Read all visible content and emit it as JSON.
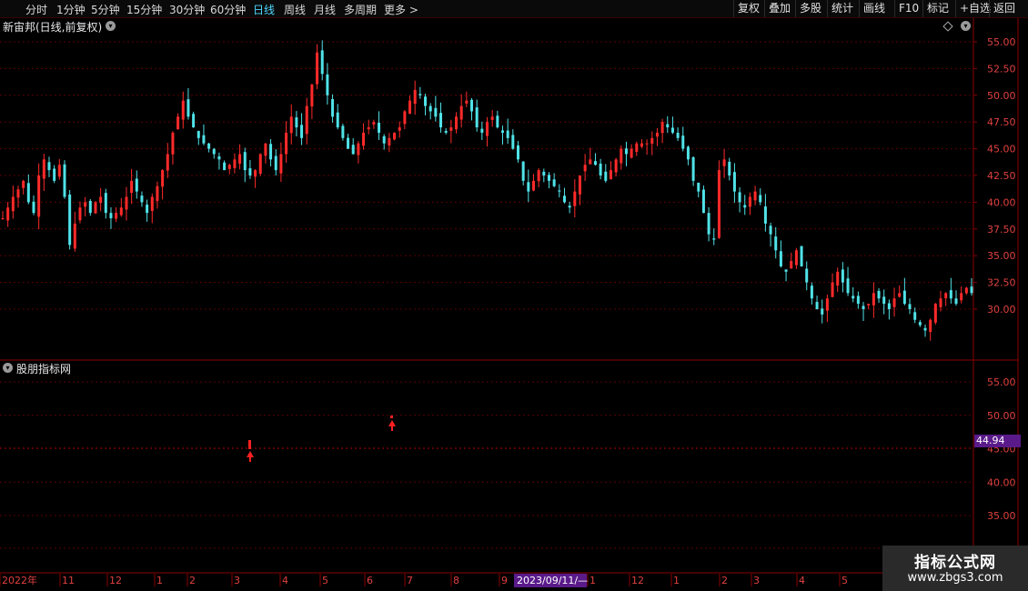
{
  "toolbar": {
    "periods": [
      "分时",
      "1分钟",
      "5分钟",
      "15分钟",
      "30分钟",
      "60分钟",
      "日线",
      "周线",
      "月线",
      "多周期",
      "更多 >"
    ],
    "active_period": "日线",
    "right_buttons": [
      "复权",
      "叠加",
      "多股",
      "统计",
      "画线",
      "F10",
      "标记",
      "+自选",
      "返回"
    ]
  },
  "main_panel": {
    "title": "新宙邦(日线,前复权)",
    "y_ticks": [
      "55.00",
      "52.50",
      "50.00",
      "47.50",
      "45.00",
      "42.50",
      "40.00",
      "37.50",
      "35.00",
      "32.50",
      "30.00"
    ]
  },
  "indicator_panel": {
    "title": "股朋指标网",
    "y_ticks": [
      "55.00",
      "50.00",
      "45.00",
      "40.00",
      "35.00"
    ],
    "current_value": "44.94"
  },
  "x_axis": {
    "labels": [
      "2022年",
      "11",
      "12",
      "1",
      "2",
      "3",
      "4",
      "5",
      "6",
      "7",
      "8",
      "9",
      "1",
      "12",
      "1",
      "2",
      "3",
      "4",
      "5"
    ],
    "cursor_date": "2023/09/11/—"
  },
  "watermark": {
    "title": "指标公式网",
    "url": "www.zbgs3.com"
  },
  "colors": {
    "up": "#ff2a2a",
    "down": "#4fe3e8",
    "grid": "#5a0000",
    "axis": "#8b0000",
    "accent": "#4fd6ff"
  },
  "chart_data": {
    "type": "candlestick",
    "title": "新宙邦(日线,前复权)",
    "xlabel": "",
    "ylabel": "",
    "ylim": [
      27.5,
      56.0
    ],
    "grid": true,
    "values": [
      38.5,
      39.5,
      40.5,
      41.2,
      42.0,
      40.0,
      39.0,
      42.5,
      44.0,
      43.0,
      42.0,
      43.5,
      40.5,
      36.0,
      38.0,
      39.5,
      40.0,
      39.0,
      40.0,
      40.5,
      39.0,
      38.5,
      39.0,
      39.5,
      40.5,
      42.0,
      41.0,
      40.0,
      39.0,
      40.5,
      41.5,
      43.0,
      44.5,
      46.5,
      48.0,
      49.5,
      48.0,
      47.0,
      46.0,
      45.5,
      45.0,
      44.5,
      44.0,
      43.0,
      43.5,
      44.0,
      44.5,
      43.0,
      42.5,
      43.0,
      44.5,
      45.5,
      44.0,
      43.0,
      44.5,
      46.5,
      48.0,
      47.0,
      46.0,
      49.0,
      51.0,
      54.0,
      52.0,
      50.0,
      48.0,
      47.0,
      46.0,
      45.0,
      44.5,
      45.5,
      46.5,
      47.0,
      47.5,
      46.5,
      45.5,
      46.0,
      46.5,
      47.0,
      48.5,
      49.5,
      50.5,
      50.0,
      49.0,
      48.5,
      48.0,
      47.0,
      46.5,
      47.0,
      48.0,
      49.0,
      49.5,
      48.5,
      47.0,
      46.5,
      47.5,
      48.0,
      47.0,
      46.5,
      46.0,
      45.0,
      44.0,
      42.0,
      41.0,
      42.0,
      43.0,
      42.5,
      42.0,
      41.5,
      41.0,
      40.0,
      39.5,
      41.0,
      42.5,
      43.5,
      44.0,
      43.5,
      42.5,
      42.0,
      43.0,
      44.0,
      45.0,
      44.5,
      45.0,
      45.5,
      45.5,
      45.5,
      46.0,
      46.5,
      47.5,
      47.0,
      46.5,
      46.0,
      45.0,
      44.0,
      42.0,
      41.0,
      39.0,
      37.0,
      36.5,
      43.0,
      44.0,
      42.5,
      41.0,
      40.0,
      39.5,
      40.5,
      41.0,
      40.0,
      38.0,
      37.0,
      35.5,
      34.0,
      33.5,
      34.5,
      35.5,
      34.0,
      32.5,
      31.0,
      30.0,
      29.5,
      31.0,
      32.5,
      33.5,
      32.5,
      31.5,
      31.0,
      30.5,
      30.0,
      30.5,
      31.5,
      31.0,
      30.5,
      30.0,
      31.0,
      31.5,
      30.5,
      30.0,
      29.0,
      28.5,
      28.0,
      29.0,
      30.5,
      31.0,
      31.5,
      31.0,
      30.5,
      31.5,
      32.0,
      31.5
    ]
  }
}
